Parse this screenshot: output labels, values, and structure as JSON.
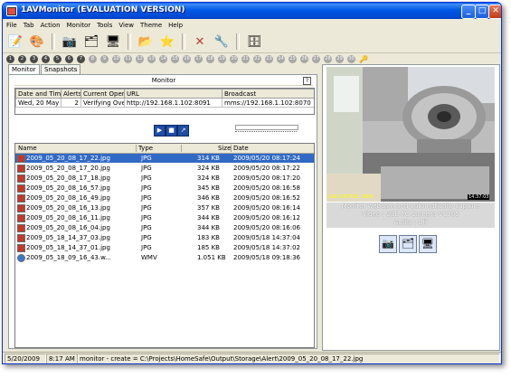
{
  "window": {
    "title": "1AVMonitor (EVALUATION VERSION)",
    "buttons": {
      "minimize": "_",
      "maximize": "□",
      "close": "✕"
    }
  },
  "menu": [
    "File",
    "Tab",
    "Action",
    "Monitor",
    "Tools",
    "View",
    "Theme",
    "Help"
  ],
  "toolbar_icons": [
    "notepad-icon",
    "palette-icon",
    "camera-icon",
    "folder-window-icon",
    "screen-icon",
    "open-folder-icon",
    "star-arrow-icon",
    "close-x-icon",
    "tools-icon",
    "database-icon"
  ],
  "camera_slots": [
    "1",
    "2",
    "3",
    "4",
    "5",
    "6",
    "7",
    "8",
    "9",
    "10",
    "11",
    "12",
    "13",
    "14",
    "15",
    "16",
    "17",
    "18",
    "19",
    "20",
    "21",
    "22",
    "23",
    "24",
    "25",
    "26",
    "27",
    "28",
    "29",
    "30"
  ],
  "tabs": [
    "Monitor",
    "Snapshots"
  ],
  "monitor": {
    "title": "Monitor",
    "help": "?",
    "headers": [
      "Date and Time",
      "Alerts",
      "Current Operation",
      "URL",
      "Broadcast"
    ],
    "row": [
      "Wed, 20 May ...",
      "2",
      "Verifying Over...",
      "http://192.168.1.102:8091",
      "mms://192.168.1.102:8070"
    ]
  },
  "controls": [
    "▶",
    "■",
    "↗"
  ],
  "files": {
    "headers": {
      "name": "Name",
      "type": "Type",
      "size": "Size",
      "date": "Date"
    },
    "rows": [
      {
        "name": "2009_05_20_08_17_22.jpg",
        "type": "JPG",
        "size": "314 KB",
        "date": "2009/05/20 08:17:24",
        "icon": "jpg"
      },
      {
        "name": "2009_05_20_08_17_20.jpg",
        "type": "JPG",
        "size": "324 KB",
        "date": "2009/05/20 08:17:22",
        "icon": "jpg"
      },
      {
        "name": "2009_05_20_08_17_18.jpg",
        "type": "JPG",
        "size": "324 KB",
        "date": "2009/05/20 08:17:20",
        "icon": "jpg"
      },
      {
        "name": "2009_05_20_08_16_57.jpg",
        "type": "JPG",
        "size": "345 KB",
        "date": "2009/05/20 08:16:58",
        "icon": "jpg"
      },
      {
        "name": "2009_05_20_08_16_49.jpg",
        "type": "JPG",
        "size": "346 KB",
        "date": "2009/05/20 08:16:52",
        "icon": "jpg"
      },
      {
        "name": "2009_05_20_08_16_13.jpg",
        "type": "JPG",
        "size": "357 KB",
        "date": "2009/05/20 08:16:14",
        "icon": "jpg"
      },
      {
        "name": "2009_05_20_08_16_11.jpg",
        "type": "JPG",
        "size": "344 KB",
        "date": "2009/05/20 08:16:12",
        "icon": "jpg"
      },
      {
        "name": "2009_05_20_08_16_04.jpg",
        "type": "JPG",
        "size": "344 KB",
        "date": "2009/05/20 08:16:06",
        "icon": "jpg"
      },
      {
        "name": "2009_05_18_14_37_03.jpg",
        "type": "JPG",
        "size": "183 KB",
        "date": "2009/05/18 14:37:04",
        "icon": "jpg"
      },
      {
        "name": "2009_05_18_14_37_01.jpg",
        "type": "JPG",
        "size": "185 KB",
        "date": "2009/05/18 14:37:02",
        "icon": "jpg"
      },
      {
        "name": "2009_05_18_09_16_43.w...",
        "type": "WMV",
        "size": "1.051 KB",
        "date": "2009/05/18 09:18:36",
        "icon": "wmv"
      }
    ]
  },
  "preview": {
    "caption": "LAB CONTROL VIEW",
    "timestamp": "14:37:03",
    "info": [
      "Monitor webcam and automatically capture",
      "Video : USB PC Camera VC305",
      "Audio : Off"
    ],
    "buttons": [
      "camera-icon",
      "folder-window-icon",
      "screen-icon"
    ]
  },
  "status": {
    "date": "5/20/2009",
    "time": "8:17 AM",
    "message": "monitor - create = C:\\Projects\\HomeSafe\\Output\\Storage\\Alert\\2009_05_20_08_17_22.jpg"
  },
  "colors": {
    "title_bar": "#0058e6",
    "selection": "#316ac5",
    "face": "#ece9d8"
  }
}
